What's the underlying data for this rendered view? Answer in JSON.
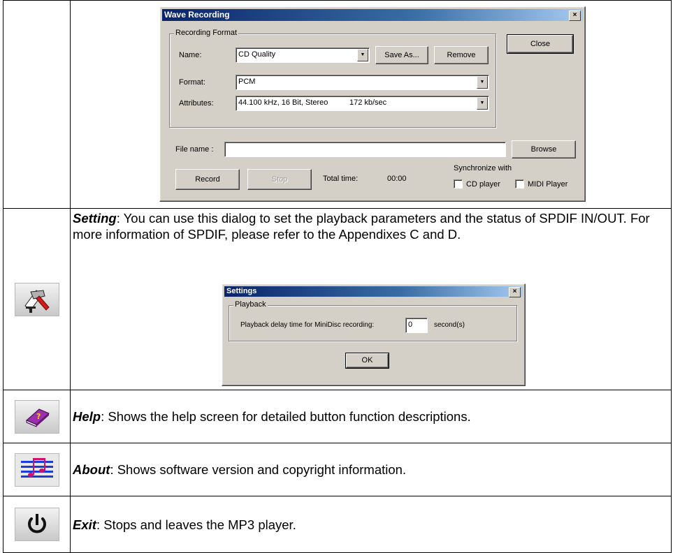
{
  "wave_dialog": {
    "title": "Wave Recording",
    "close_x": "×",
    "recording_format_label": "Recording Format",
    "name_label": "Name:",
    "name_value": "CD Quality",
    "save_as_button": "Save As...",
    "remove_button": "Remove",
    "close_button": "Close",
    "format_label": "Format:",
    "format_value": "PCM",
    "attributes_label": "Attributes:",
    "attributes_value": "44.100 kHz, 16 Bit, Stereo          172 kb/sec",
    "file_name_label": "File name :",
    "file_name_value": "",
    "browse_button": "Browse",
    "record_button": "Record",
    "stop_button": "Stop",
    "total_time_label": "Total time:",
    "total_time_value": "00:00",
    "synchronize_label": "Synchronize with",
    "cd_player_label": "CD player",
    "midi_player_label": "MIDI Player"
  },
  "setting_row": {
    "term": "Setting",
    "description": ": You can use this dialog to set the playback parameters and the status of SPDIF IN/OUT. For more information of SPDIF, please refer to the Appendixes C and D.",
    "icon": "hammer-icon"
  },
  "settings_dialog": {
    "title": "Settings",
    "close_x": "×",
    "playback_group": "Playback",
    "delay_label": "Playback delay time for MiniDisc recording:",
    "delay_value": "0",
    "unit_label": "second(s)",
    "ok_button": "OK"
  },
  "help_row": {
    "term": "Help",
    "description": ": Shows the help screen for detailed button function descriptions.",
    "icon": "help-book-icon"
  },
  "about_row": {
    "term": "About",
    "description": ": Shows software version and copyright information.",
    "icon": "music-staff-icon"
  },
  "exit_row": {
    "term": "Exit",
    "description": ": Stops and leaves the MP3 player.",
    "icon": "power-icon"
  },
  "colors": {
    "titlebar": "#0a246a",
    "dialog_face": "#d4d0c8",
    "help_book": "#9b2fae",
    "music_staff": "#1c3cd8",
    "music_notes": "#d01070"
  }
}
